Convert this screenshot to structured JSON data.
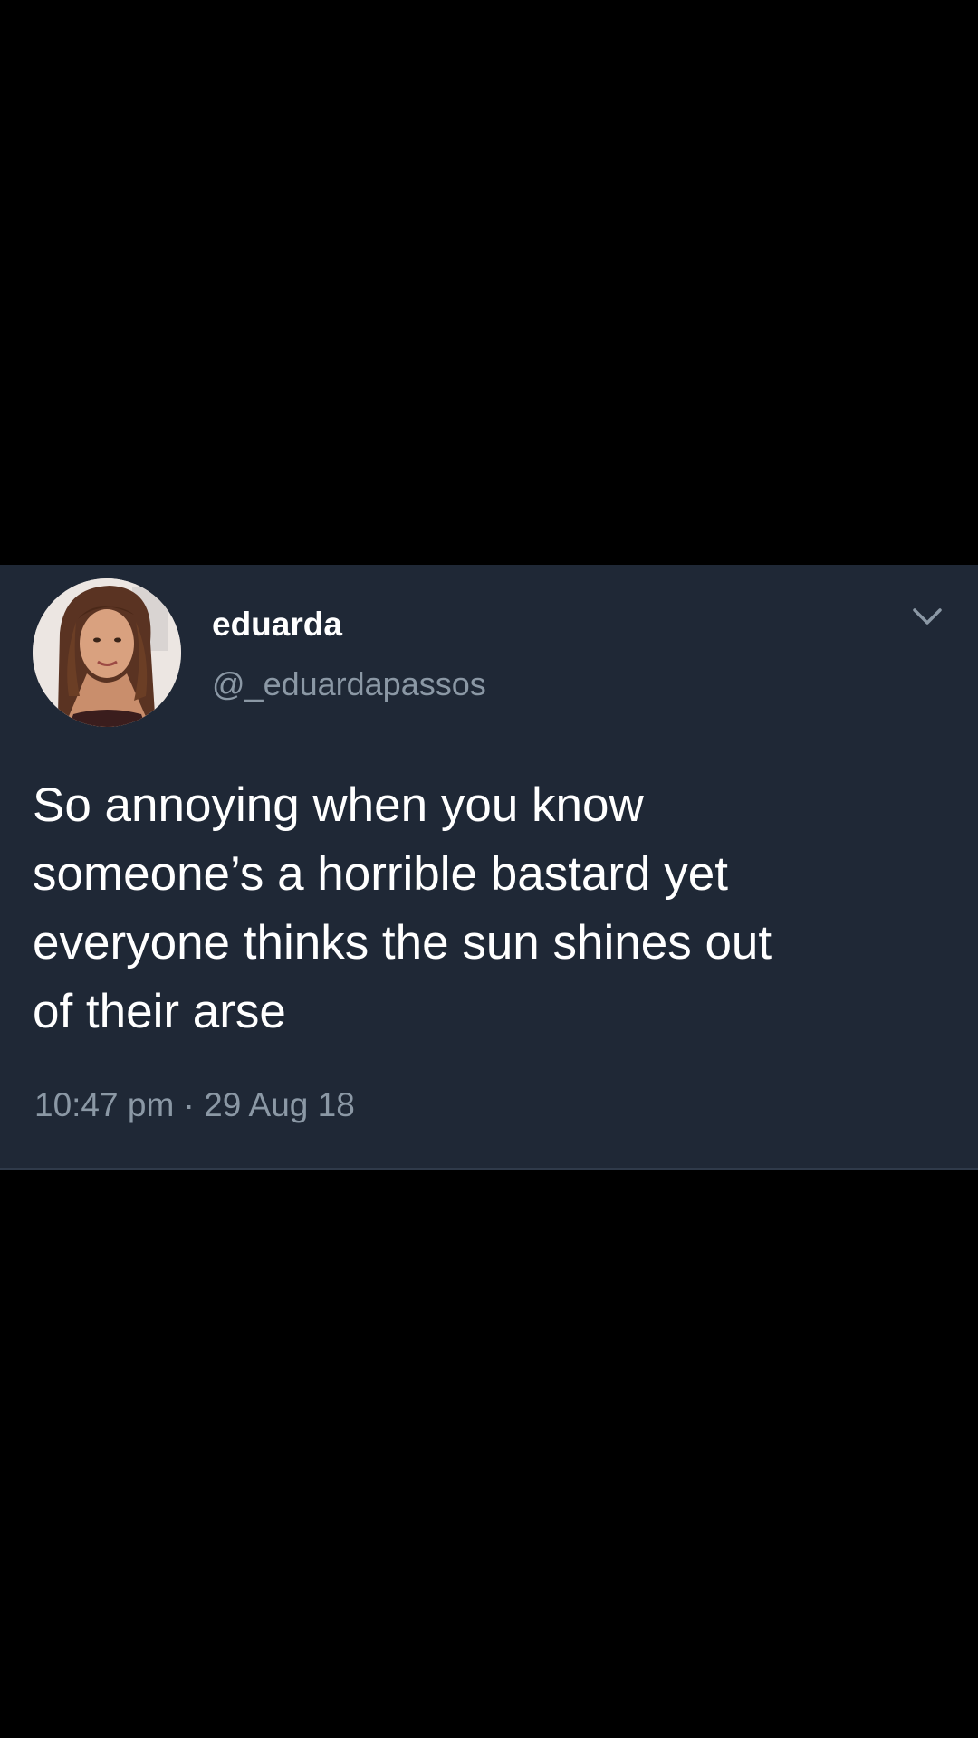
{
  "tweet": {
    "display_name": "eduarda",
    "handle": "@_eduardapassos",
    "text_lines": [
      "So annoying when you know",
      "someone’s a horrible bastard yet",
      "everyone thinks the sun shines out",
      "of their arse"
    ],
    "timestamp": "10:47 pm · 29 Aug 18",
    "icons": {
      "avatar": "profile-photo",
      "menu": "chevron-down-icon"
    }
  },
  "colors": {
    "page_background": "#000000",
    "card_background": "#1f2836",
    "primary_text": "#ffffff",
    "secondary_text": "#8b98a5"
  }
}
